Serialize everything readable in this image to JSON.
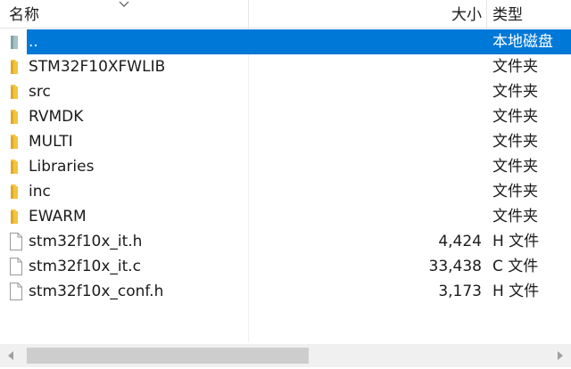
{
  "header": {
    "name_label": "名称",
    "size_label": "大小",
    "type_label": "类型"
  },
  "rows": [
    {
      "name": "..",
      "size": "",
      "type": "本地磁盘",
      "icon": "up-folder-icon",
      "selected": true
    },
    {
      "name": "STM32F10XFWLIB",
      "size": "",
      "type": "文件夹",
      "icon": "folder-icon",
      "selected": false
    },
    {
      "name": "src",
      "size": "",
      "type": "文件夹",
      "icon": "folder-icon",
      "selected": false
    },
    {
      "name": "RVMDK",
      "size": "",
      "type": "文件夹",
      "icon": "folder-icon",
      "selected": false
    },
    {
      "name": "MULTI",
      "size": "",
      "type": "文件夹",
      "icon": "folder-icon",
      "selected": false
    },
    {
      "name": "Libraries",
      "size": "",
      "type": "文件夹",
      "icon": "folder-icon",
      "selected": false
    },
    {
      "name": "inc",
      "size": "",
      "type": "文件夹",
      "icon": "folder-icon",
      "selected": false
    },
    {
      "name": "EWARM",
      "size": "",
      "type": "文件夹",
      "icon": "folder-icon",
      "selected": false
    },
    {
      "name": "stm32f10x_it.h",
      "size": "4,424",
      "type": "H 文件",
      "icon": "file-icon",
      "selected": false
    },
    {
      "name": "stm32f10x_it.c",
      "size": "33,438",
      "type": "C 文件",
      "icon": "file-icon",
      "selected": false
    },
    {
      "name": "stm32f10x_conf.h",
      "size": "3,173",
      "type": "H 文件",
      "icon": "file-icon",
      "selected": false
    }
  ],
  "colors": {
    "selection": "#0078d7",
    "folder": "#f2c53d"
  }
}
